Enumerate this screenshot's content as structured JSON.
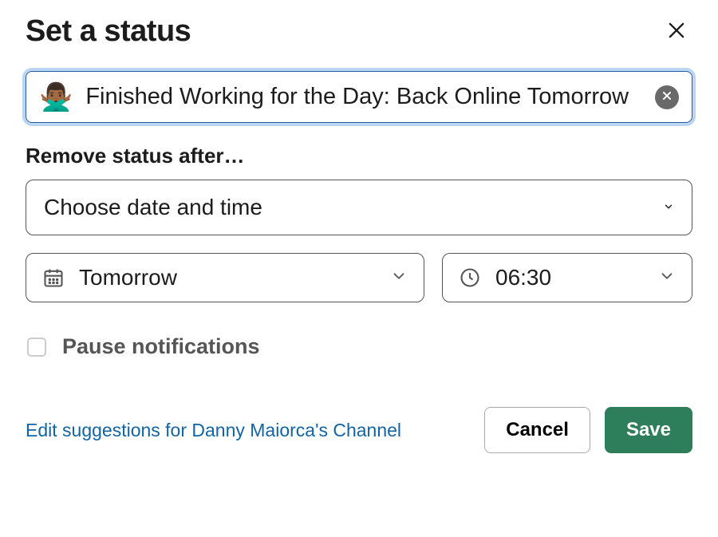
{
  "dialog": {
    "title": "Set a status"
  },
  "status": {
    "emoji": "🙅🏾‍♂️",
    "text": "Finished Working for the Day: Back Online Tomorrow"
  },
  "remove": {
    "section_label": "Remove status after…",
    "mode_label": "Choose date and time",
    "date_label": "Tomorrow",
    "time_label": "06:30"
  },
  "pause": {
    "label": "Pause notifications",
    "checked": false
  },
  "footer": {
    "link": "Edit suggestions for Danny Maiorca's Channel",
    "cancel": "Cancel",
    "save": "Save"
  }
}
